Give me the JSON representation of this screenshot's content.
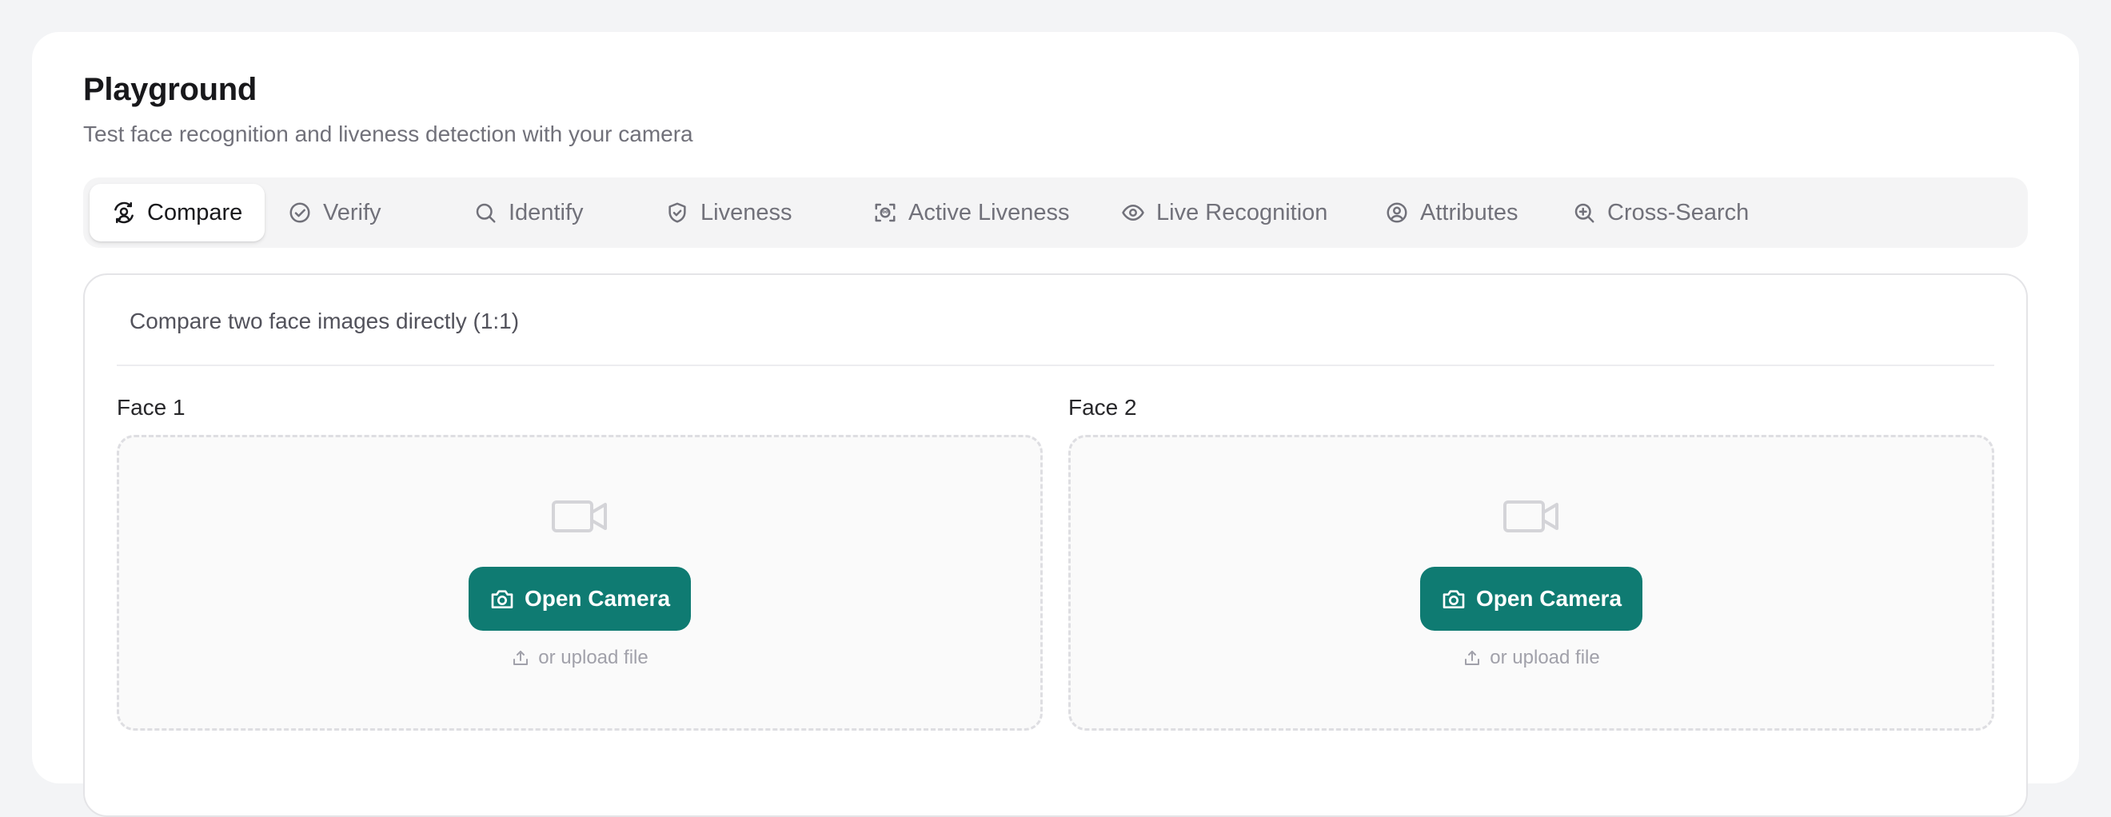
{
  "page": {
    "title": "Playground",
    "subtitle": "Test face recognition and liveness detection with your camera"
  },
  "tabs": [
    {
      "label": "Compare",
      "icon": "compare-face-icon",
      "active": true
    },
    {
      "label": "Verify",
      "icon": "check-circle-icon",
      "active": false
    },
    {
      "label": "Identify",
      "icon": "search-icon",
      "active": false
    },
    {
      "label": "Liveness",
      "icon": "shield-check-icon",
      "active": false
    },
    {
      "label": "Active Liveness",
      "icon": "face-scan-icon",
      "active": false
    },
    {
      "label": "Live Recognition",
      "icon": "eye-icon",
      "active": false
    },
    {
      "label": "Attributes",
      "icon": "user-circle-icon",
      "active": false
    },
    {
      "label": "Cross-Search",
      "icon": "zoom-in-icon",
      "active": false
    }
  ],
  "panel": {
    "description": "Compare two face images directly (1:1)",
    "faces": [
      {
        "label": "Face 1",
        "button_label": "Open Camera",
        "upload_label": "or upload file"
      },
      {
        "label": "Face 2",
        "button_label": "Open Camera",
        "upload_label": "or upload file"
      }
    ]
  },
  "colors": {
    "accent": "#0f7b72",
    "background": "#f3f4f6",
    "muted_text": "#71717a"
  }
}
